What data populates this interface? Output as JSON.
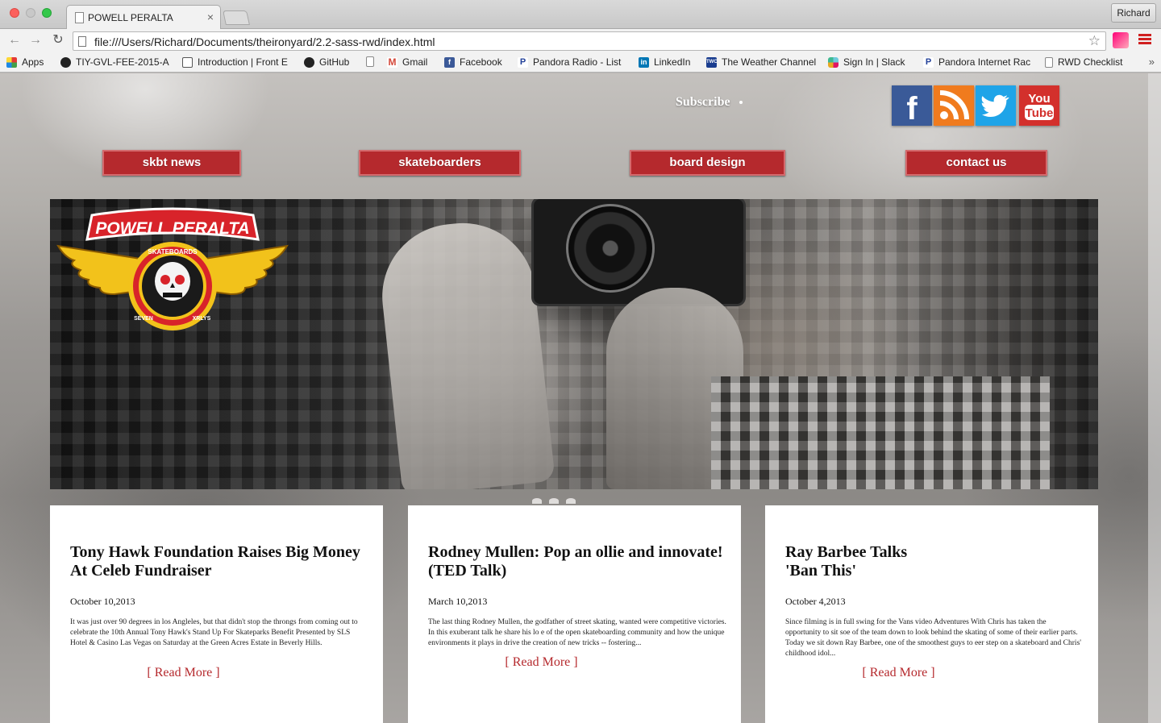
{
  "browser": {
    "tab_title": "POWELL PERALTA",
    "tab_close": "×",
    "profile": "Richard",
    "url": "file:///Users/Richard/Documents/theironyard/2.2-sass-rwd/index.html",
    "back": "←",
    "forward": "→",
    "reload": "↻",
    "star": "☆",
    "bookmarks": [
      {
        "label": "Apps",
        "icon": "apps-icon",
        "color": "#e64a19"
      },
      {
        "label": "TIY-GVL-FEE-2015-A",
        "icon": "github-icon",
        "color": "#222222"
      },
      {
        "label": "Introduction | Front E",
        "icon": "book-icon",
        "color": "#555555"
      },
      {
        "label": "GitHub",
        "icon": "github-icon",
        "color": "#222222"
      },
      {
        "label": "",
        "icon": "page-icon",
        "color": "#cccccc"
      },
      {
        "label": "Gmail",
        "icon": "gmail-icon",
        "color": "#d44638"
      },
      {
        "label": "Facebook",
        "icon": "facebook-icon",
        "color": "#3b5998"
      },
      {
        "label": "Pandora Radio - List",
        "icon": "pandora-icon",
        "color": "#224099"
      },
      {
        "label": "LinkedIn",
        "icon": "linkedin-icon",
        "color": "#0077b5"
      },
      {
        "label": "The Weather Channel",
        "icon": "weather-icon",
        "color": "#1a3d8f"
      },
      {
        "label": "Sign In | Slack",
        "icon": "slack-icon",
        "color": "#6ecadc"
      },
      {
        "label": "Pandora Internet Rac",
        "icon": "pandora-icon",
        "color": "#224099"
      },
      {
        "label": "RWD Checklist",
        "icon": "page-icon",
        "color": "#cccccc"
      }
    ],
    "bookmarks_more": "»"
  },
  "site": {
    "subscribe": "Subscribe",
    "social": {
      "facebook": "f",
      "youtube_top": "You",
      "youtube_bottom": "Tube"
    },
    "nav": [
      {
        "label": "skbt news"
      },
      {
        "label": "skateboarders"
      },
      {
        "label": "board design"
      },
      {
        "label": "contact us"
      }
    ],
    "logo": {
      "brand": "POWELL PERALTA",
      "sub": "SKATEBOARDS",
      "left_text": "SEVEN",
      "right_text": "XRLYS"
    },
    "articles": [
      {
        "title": "Tony Hawk Foundation Raises Big Money At Celeb Fundraiser",
        "date": "October 10,2013",
        "body": "It was just over 90 degrees in los Angleles, but that didn't stop the throngs from coming out to celebrate the 10th Annual Tony Hawk's Stand Up For Skateparks Benefit Presented by SLS Hotel & Casino Las Vegas on Saturday at the Green Acres Estate in Beverly Hills.",
        "more": "[ Read More ]"
      },
      {
        "title": "Rodney Mullen: Pop an ollie and innovate! (TED Talk)",
        "date": "March 10,2013",
        "body": "The last thing Rodney Mullen, the godfather of street skating, wanted were competitive victories. In this exuberant talk he share his lo e of the open skateboarding community and how the unique environments it plays in drive the creation of new tricks -- fostering...",
        "more": "[ Read More ]"
      },
      {
        "title": "Ray Barbee Talks 'Ban This'",
        "date": "October 4,2013",
        "body": "Since filming is in full swing for the Vans video Adventures With Chris has taken the opportunity to sit soe of the team down to look behind the skating of some of their earlier parts. Today we sit down Ray Barbee, one of the smoothest guys to eer step on a skateboard and Chris' childhood idol...",
        "more": "[ Read More ]"
      }
    ],
    "colors": {
      "nav_red": "#b5292d",
      "read_more": "#b5292d"
    }
  }
}
